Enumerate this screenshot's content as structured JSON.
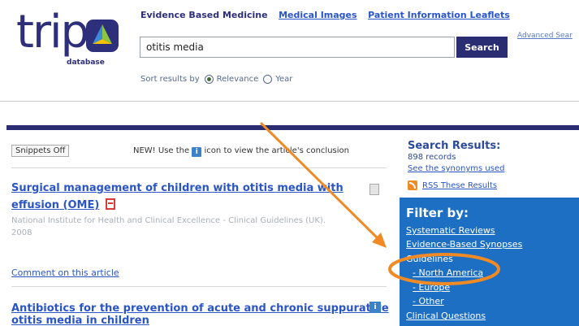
{
  "logo": {
    "word": "trip",
    "subtitle": "database"
  },
  "nav": {
    "evidence_based": "Evidence Based Medicine",
    "medical_images": "Medical Images",
    "patient_leaflets": "Patient Information Leaflets",
    "advanced_search": "Advanced Sear"
  },
  "search": {
    "value": "otitis media",
    "button": "Search"
  },
  "sort": {
    "label": "Sort results by",
    "option_relevance": "Relevance",
    "option_year": "Year",
    "selected": "Relevance"
  },
  "snippets": {
    "button": "Snippets Off"
  },
  "newnote": {
    "before": "NEW! Use the",
    "after": "icon to view the article's conclusion"
  },
  "results": [
    {
      "title_line1": "Surgical management of children with otitis media with",
      "title_line2": "effusion (OME)",
      "meta_line1": "National Institute for Health and Clinical Excellence - Clinical Guidelines (UK).",
      "meta_line2": "2008",
      "comment": "Comment on this article"
    },
    {
      "title_line1": "Antibiotics for the prevention of acute and chronic suppurative",
      "title_line2": "otitis media in children"
    }
  ],
  "sidebar": {
    "title": "Search Results:",
    "records": "898 records",
    "synonyms": "See the synonyms used",
    "rss": "RSS These Results"
  },
  "filter": {
    "title": "Filter by:",
    "items": [
      "Systematic Reviews",
      "Evidence-Based Synopses",
      "Guidelines",
      "- North America",
      "- Europe",
      "- Other",
      "Clinical Questions"
    ]
  },
  "colors": {
    "brand": "#2b2d73",
    "link": "#2a55c6",
    "filter_bg": "#1d6fc4",
    "annotation": "#f08a24"
  }
}
